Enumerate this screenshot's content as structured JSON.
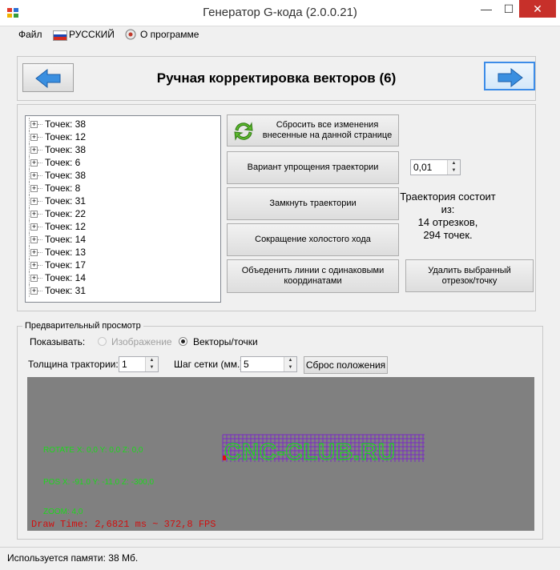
{
  "window": {
    "title": "Генератор G-кода (2.0.0.21)",
    "min_label": "—",
    "max_label": "☐",
    "close_label": "✕"
  },
  "menu": {
    "file": "Файл",
    "language": "РУССКИЙ",
    "about": "О программе"
  },
  "header": {
    "title": "Ручная корректировка векторов (6)"
  },
  "tree": {
    "items": [
      "Точек: 38",
      "Точек: 12",
      "Точек: 38",
      "Точек: 6",
      "Точек: 38",
      "Точек: 8",
      "Точек: 31",
      "Точек: 22",
      "Точек: 12",
      "Точек: 14",
      "Точек: 13",
      "Точек: 17",
      "Точек: 14",
      "Точек: 31"
    ]
  },
  "buttons": {
    "reset": [
      "Сбросить все изменения",
      "внесенные на данной странице"
    ],
    "simplify": "Вариант упрощения траектории",
    "close_paths": "Замкнуть траектории",
    "reduce_idle": "Сокращение холостого хода",
    "merge": [
      "Объеденить линии с одинаковыми",
      "координатами"
    ],
    "delete": [
      "Удалить выбранный",
      "отрезок/точку"
    ]
  },
  "simplify_value": "0,01",
  "info": {
    "line1": "Траектория состоит",
    "line2": "из:",
    "line3": "14 отрезков,",
    "line4": "294 точек."
  },
  "preview": {
    "legend": "Предварительный просмотр",
    "show_label": "Показывать:",
    "opt_image": "Изображение",
    "opt_vectors": "Векторы/точки",
    "thickness_label": "Толщина трактории:",
    "thickness_value": "1",
    "grid_label": "Шаг сетки (мм.):",
    "grid_value": "5",
    "reset_pos": "Сброс положения"
  },
  "canvas": {
    "rotate": "ROTATE X: 0,0  Y: 0,0 Z: 0,0",
    "pos": "POS X: -91,0  Y: -11,0 Z: -300,0",
    "zoom": "ZOOM: 4,0",
    "drawtime": "Draw Time: 2,6821 ms ~ 372,8 FPS",
    "logo_text": "CNC-CLUB.RU",
    "colors": {
      "background": "#808080",
      "grid": "#7b2cc4",
      "text": "#1cd81c",
      "drawtime": "#d01010"
    }
  },
  "status": {
    "memory": "Используется памяти:  38  Мб."
  }
}
